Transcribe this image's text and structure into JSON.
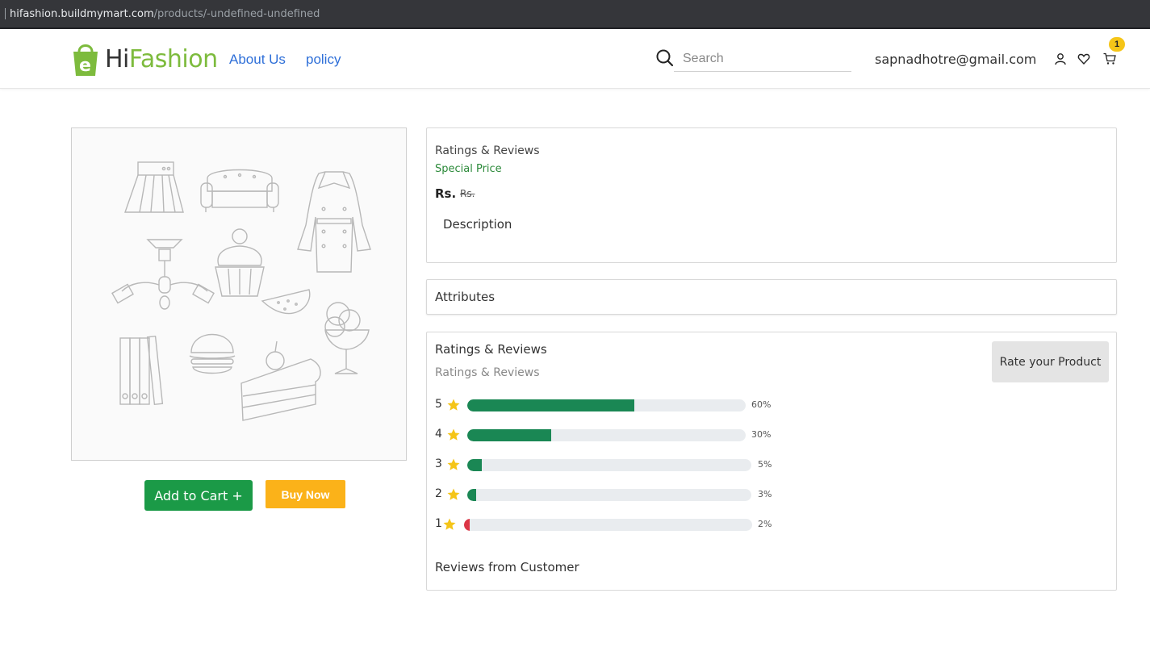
{
  "browser": {
    "url_host": "hifashion.buildmymart.com",
    "url_path": "/products/-undefined-undefined"
  },
  "header": {
    "logo": {
      "brand_hi": "Hi",
      "brand_fashion": "Fashion",
      "icon_letter": "e",
      "color": "#7dbb3d"
    },
    "nav": {
      "about": "About Us",
      "policy": "policy"
    },
    "search": {
      "placeholder": "Search",
      "value": ""
    },
    "user_email": "sapnadhotre@gmail.com",
    "cart_count": "1",
    "icons": [
      "search-icon",
      "user-icon",
      "heart-icon",
      "cart-icon"
    ]
  },
  "product": {
    "actions": {
      "add_to_cart": "Add to Cart +",
      "buy_now": "Buy Now"
    },
    "info": {
      "ratings_label": "Ratings & Reviews",
      "special_price": "Special Price",
      "price_label": "Rs.",
      "old_price_label": "Rs.",
      "description_title": "Description"
    },
    "attributes_title": "Attributes"
  },
  "ratings": {
    "title": "Ratings & Reviews",
    "subtitle": "Ratings & Reviews",
    "rate_button": "Rate your Product",
    "rows": [
      {
        "stars": "5",
        "percent": 60,
        "label": "60%",
        "color": "#1a8754"
      },
      {
        "stars": "4",
        "percent": 30,
        "label": "30%",
        "color": "#1a8754"
      },
      {
        "stars": "3",
        "percent": 5,
        "label": "5%",
        "color": "#1a8754"
      },
      {
        "stars": "2",
        "percent": 3,
        "label": "3%",
        "color": "#1a8754"
      },
      {
        "stars": "1",
        "percent": 2,
        "label": "2%",
        "color": "#dc3545"
      }
    ],
    "reviews_from_customer": "Reviews from Customer"
  },
  "colors": {
    "accent_link": "#2e6fd8",
    "add_to_cart": "#1b9a47",
    "buy_now": "#fbb219",
    "star": "#f5c518",
    "badge": "#f5c518"
  }
}
